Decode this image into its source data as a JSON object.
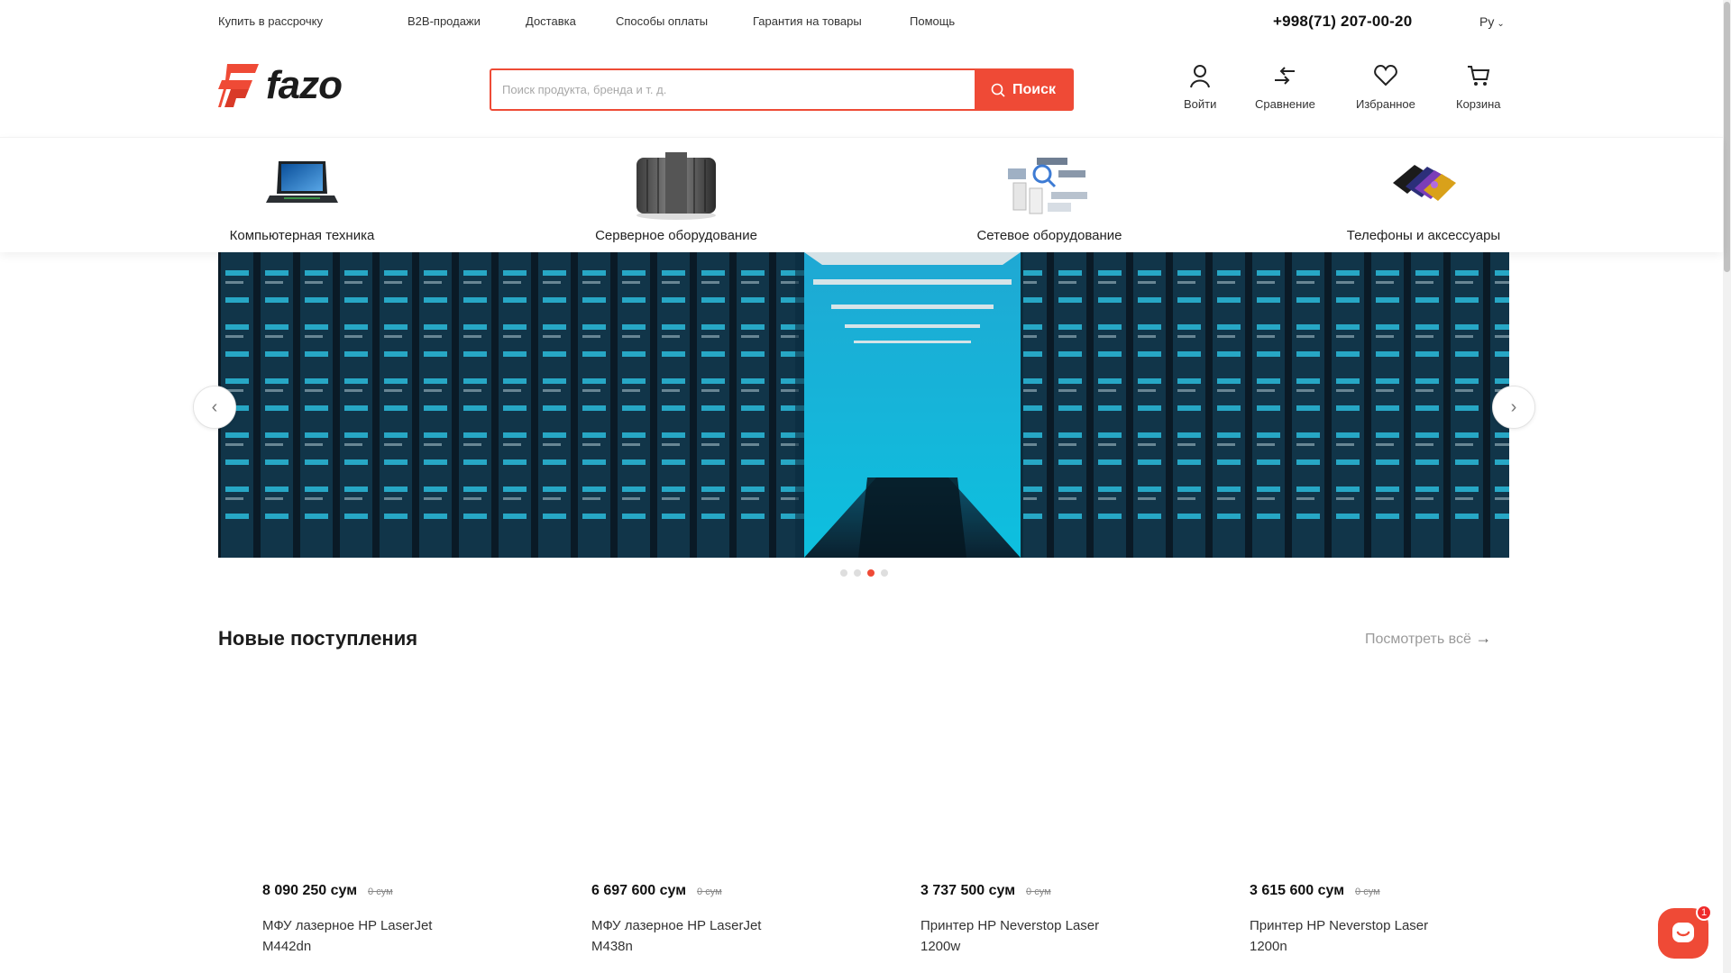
{
  "topbar": {
    "links": [
      "Купить в рассрочку",
      "B2B-продажи",
      "Доставка",
      "Способы оплаты",
      "Гарантия на товары",
      "Помощь"
    ],
    "phone": "+998(71) 207-00-20",
    "language": "Ру"
  },
  "logo": {
    "text": "fazo"
  },
  "search": {
    "placeholder": "Поиск продукта, бренда и т. д.",
    "button_label": "Поиск"
  },
  "header_actions": {
    "login": "Войти",
    "compare": "Сравнение",
    "favorites": "Избранное",
    "cart": "Корзина"
  },
  "categories": [
    {
      "label": "Компьютерная техника",
      "icon": "laptop-image"
    },
    {
      "label": "Серверное оборудование",
      "icon": "server-rack-image"
    },
    {
      "label": "Сетевое оборудование",
      "icon": "network-equipment-image"
    },
    {
      "label": "Телефоны и аксессуары",
      "icon": "phones-image"
    }
  ],
  "carousel": {
    "slide_count": 4,
    "active_slide": 3
  },
  "new_arrivals": {
    "title": "Новые поступления",
    "view_all": "Посмотреть всё",
    "products": [
      {
        "price": "8 090 250 сум",
        "old_price": "0 сум",
        "name": "МФУ лазерное HP LaserJet M442dn"
      },
      {
        "price": "6 697 600 сум",
        "old_price": "0 сум",
        "name": "МФУ лазерное HP LaserJet M438n"
      },
      {
        "price": "3 737 500 сум",
        "old_price": "0 сум",
        "name": "Принтер HP Neverstop Laser 1200w"
      },
      {
        "price": "3 615 600 сум",
        "old_price": "0 сум",
        "name": "Принтер HP Neverstop Laser 1200n"
      }
    ]
  },
  "chat": {
    "unread": "1"
  },
  "colors": {
    "accent": "#ef4a36",
    "text": "#222222",
    "muted": "#9a9a9a"
  }
}
